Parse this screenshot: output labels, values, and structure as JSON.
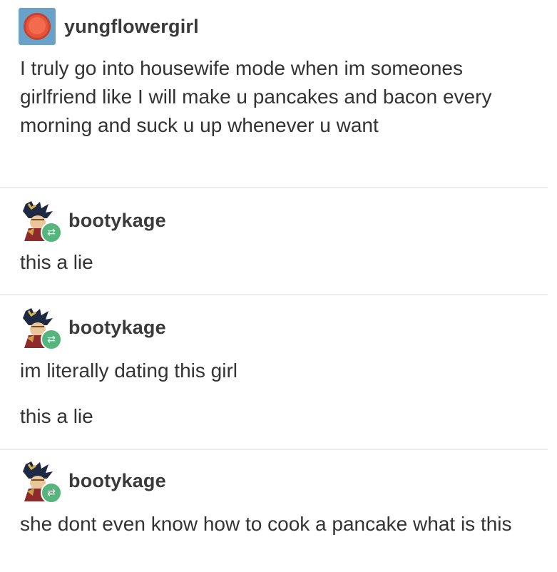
{
  "posts": [
    {
      "username": "yungflowergirl",
      "avatar_icon": "orange-circle-avatar-icon",
      "paragraphs": [
        "I truly go into housewife mode when im someones girlfriend like I will make u pancakes and bacon every morning and suck u up whenever u want"
      ]
    },
    {
      "username": "bootykage",
      "avatar_icon": "anime-figure-avatar-icon",
      "badge_icon": "reblog-icon",
      "paragraphs": [
        "this a lie"
      ]
    },
    {
      "username": "bootykage",
      "avatar_icon": "anime-figure-avatar-icon",
      "badge_icon": "reblog-icon",
      "paragraphs": [
        "im literally dating this girl",
        "this a lie"
      ]
    },
    {
      "username": "bootykage",
      "avatar_icon": "anime-figure-avatar-icon",
      "badge_icon": "reblog-icon",
      "paragraphs": [
        "she dont even know how to cook a pancake what is this"
      ]
    }
  ],
  "colors": {
    "reblog_badge": "#56b57c",
    "avatar_blue": "#6aa1c8",
    "avatar_orange": "#e4553a",
    "divider": "#ececec"
  }
}
